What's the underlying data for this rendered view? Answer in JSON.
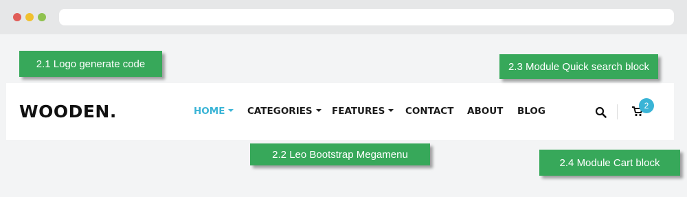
{
  "site": {
    "logo": "WOODEN.",
    "nav": [
      {
        "label": "HOME",
        "has_dropdown": true,
        "active": true
      },
      {
        "label": "CATEGORIES",
        "has_dropdown": true,
        "active": false
      },
      {
        "label": "FEATURES",
        "has_dropdown": true,
        "active": false
      },
      {
        "label": "CONTACT",
        "has_dropdown": false,
        "active": false
      },
      {
        "label": "ABOUT",
        "has_dropdown": false,
        "active": false
      },
      {
        "label": "BLOG",
        "has_dropdown": false,
        "active": false
      }
    ],
    "cart_count": "2",
    "accent_color": "#3ab4d6"
  },
  "annotations": {
    "logo": "2.1 Logo generate code",
    "megamenu": "2.2 Leo Bootstrap Megamenu",
    "search": "2.3 Module Quick search block",
    "cart": "2.4 Module Cart block",
    "color": "#37a85a"
  },
  "icons": {
    "search": "search-icon",
    "cart": "cart-icon"
  }
}
